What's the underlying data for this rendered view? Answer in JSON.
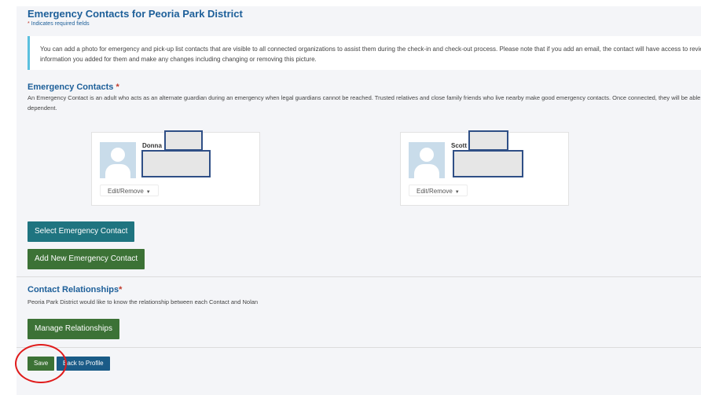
{
  "header": {
    "title": "Emergency Contacts for Peoria Park District",
    "required_note": "Indicates required fields",
    "required_star": "*"
  },
  "info": {
    "text": "You can add a photo for emergency and pick-up list contacts that are visible to all connected organizations to assist them during the check-in and check-out process. Please note that if you add an email, the contact will have access to review the information you added for them and make any changes including changing or removing this picture."
  },
  "emergency": {
    "heading": "Emergency Contacts",
    "required_star": "*",
    "description": "An Emergency Contact is an adult who acts as an alternate guardian during an emergency when legal guardians cannot be reached. Trusted relatives and close family friends who live nearby make good emergency contacts. Once connected, they will be able to view emergency information for your dependent.",
    "contacts": [
      {
        "name": "Donna",
        "detail": "",
        "edit_label": "Edit/Remove"
      },
      {
        "name": "Scott",
        "detail": "",
        "edit_label": "Edit/Remove"
      }
    ],
    "select_button": "Select Emergency Contact",
    "add_button": "Add New Emergency Contact"
  },
  "relationships": {
    "heading": "Contact Relationships",
    "required_star": "*",
    "description": "Peoria Park District would like to know the relationship between each Contact and Nolan",
    "manage_button": "Manage Relationships"
  },
  "footer": {
    "save_button": "Save",
    "back_button": "Back to Profile"
  },
  "colors": {
    "heading": "#1d5f99",
    "teal_button": "#1f7480",
    "green_button": "#3c7236",
    "blue_button": "#1a5b87",
    "info_border": "#5bc0de",
    "annotation_circle": "#e01b1b"
  }
}
